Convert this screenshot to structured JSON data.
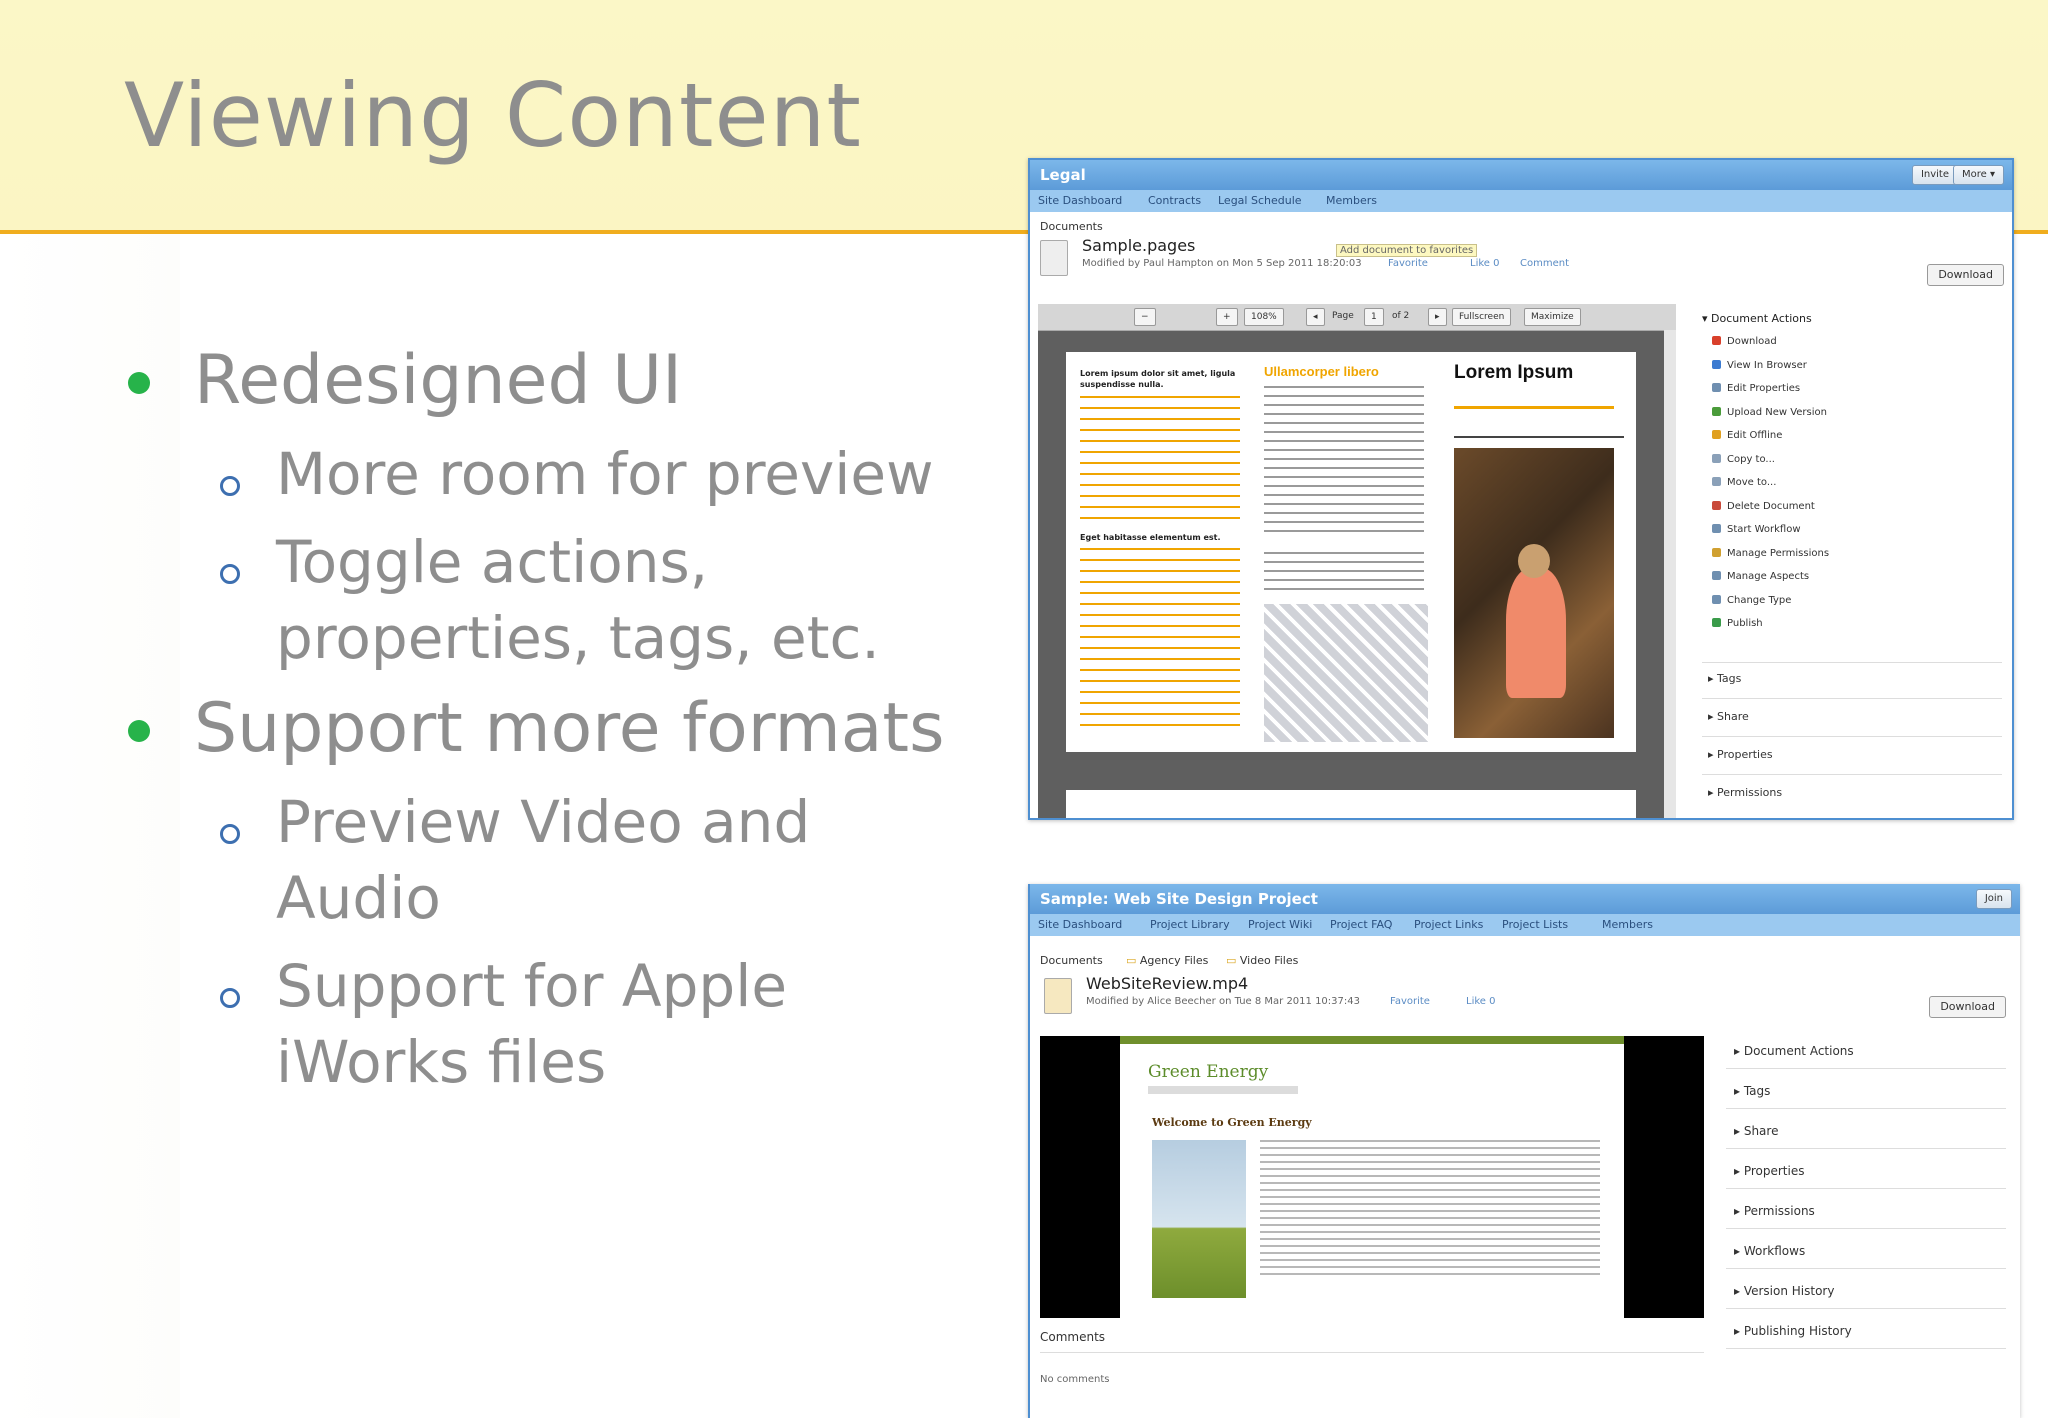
{
  "slide": {
    "title": "Viewing Content",
    "bullets": [
      {
        "text": "Redesigned UI",
        "subs": [
          "More room for preview",
          "Toggle actions,",
          "properties, tags, etc."
        ]
      },
      {
        "text": "Support more formats",
        "subs": [
          "Preview Video and",
          "Audio",
          "Support for Apple",
          "iWorks files"
        ]
      }
    ]
  },
  "shot_a": {
    "site_title": "Legal",
    "buttons": [
      "Invite",
      "More ▾"
    ],
    "nav": [
      "Site Dashboard",
      "Contracts",
      "Legal Schedule",
      "Members"
    ],
    "breadcrumb": "Documents",
    "doc_name": "Sample.pages",
    "meta": "Modified by Paul Hampton on Mon 5 Sep 2011 18:20:03",
    "tooltip": "Add document to favorites",
    "meta_links": [
      "Favorite",
      "Like 0",
      "Comment"
    ],
    "download_label": "Download",
    "toolbar": {
      "zoom": "108%",
      "page_label": "Page",
      "page_num": "1",
      "of": "of 2",
      "fullscreen": "Fullscreen",
      "maximize": "Maximize"
    },
    "preview": {
      "col1_heading": "Lorem ipsum dolor sit amet, ligula suspendisse nulla.",
      "col1_sub": "Eget habitasse elementum est.",
      "col2_heading": "Ullamcorper libero",
      "col3_heading": "Lorem Ipsum"
    },
    "sidebar": {
      "section": "▾ Document Actions",
      "actions": [
        "Download",
        "View In Browser",
        "Edit Properties",
        "Upload New Version",
        "Edit Offline",
        "Copy to...",
        "Move to...",
        "Delete Document",
        "Start Workflow",
        "Manage Permissions",
        "Manage Aspects",
        "Change Type",
        "Publish"
      ],
      "collapsed": [
        "▸ Tags",
        "▸ Share",
        "▸ Properties",
        "▸ Permissions"
      ]
    },
    "icon_colors": [
      "#d9402b",
      "#3c7bd1",
      "#6f8fb0",
      "#4a9b3a",
      "#e0a020",
      "#8aa0b8",
      "#8aa0b8",
      "#c94a3a",
      "#6f8fb0",
      "#d0a030",
      "#6f8fb0",
      "#6f8fb0",
      "#3a9b4a"
    ]
  },
  "shot_b": {
    "site_title": "Sample: Web Site Design Project",
    "button": "Join",
    "nav": [
      "Site Dashboard",
      "Project Library",
      "Project Wiki",
      "Project FAQ",
      "Project Links",
      "Project Lists",
      "Members"
    ],
    "breadcrumb": [
      "Documents",
      "Agency Files",
      "Video Files"
    ],
    "doc_name": "WebSiteReview.mp4",
    "meta": "Modified by Alice Beecher on Tue 8 Mar 2011 10:37:43",
    "meta_links": [
      "Favorite",
      "Like 0"
    ],
    "download_label": "Download",
    "video": {
      "site_title": "Green Energy",
      "welcome": "Welcome to Green Energy"
    },
    "comments_label": "Comments",
    "no_comments": "No comments",
    "sidebar": [
      "▸ Document Actions",
      "▸ Tags",
      "▸ Share",
      "▸ Properties",
      "▸ Permissions",
      "▸ Workflows",
      "▸ Version History",
      "▸ Publishing History"
    ]
  },
  "colors": {
    "accent_green": "#27b34a",
    "header_line": "#f0ad1e",
    "title_bar": "#5c9bd8"
  }
}
